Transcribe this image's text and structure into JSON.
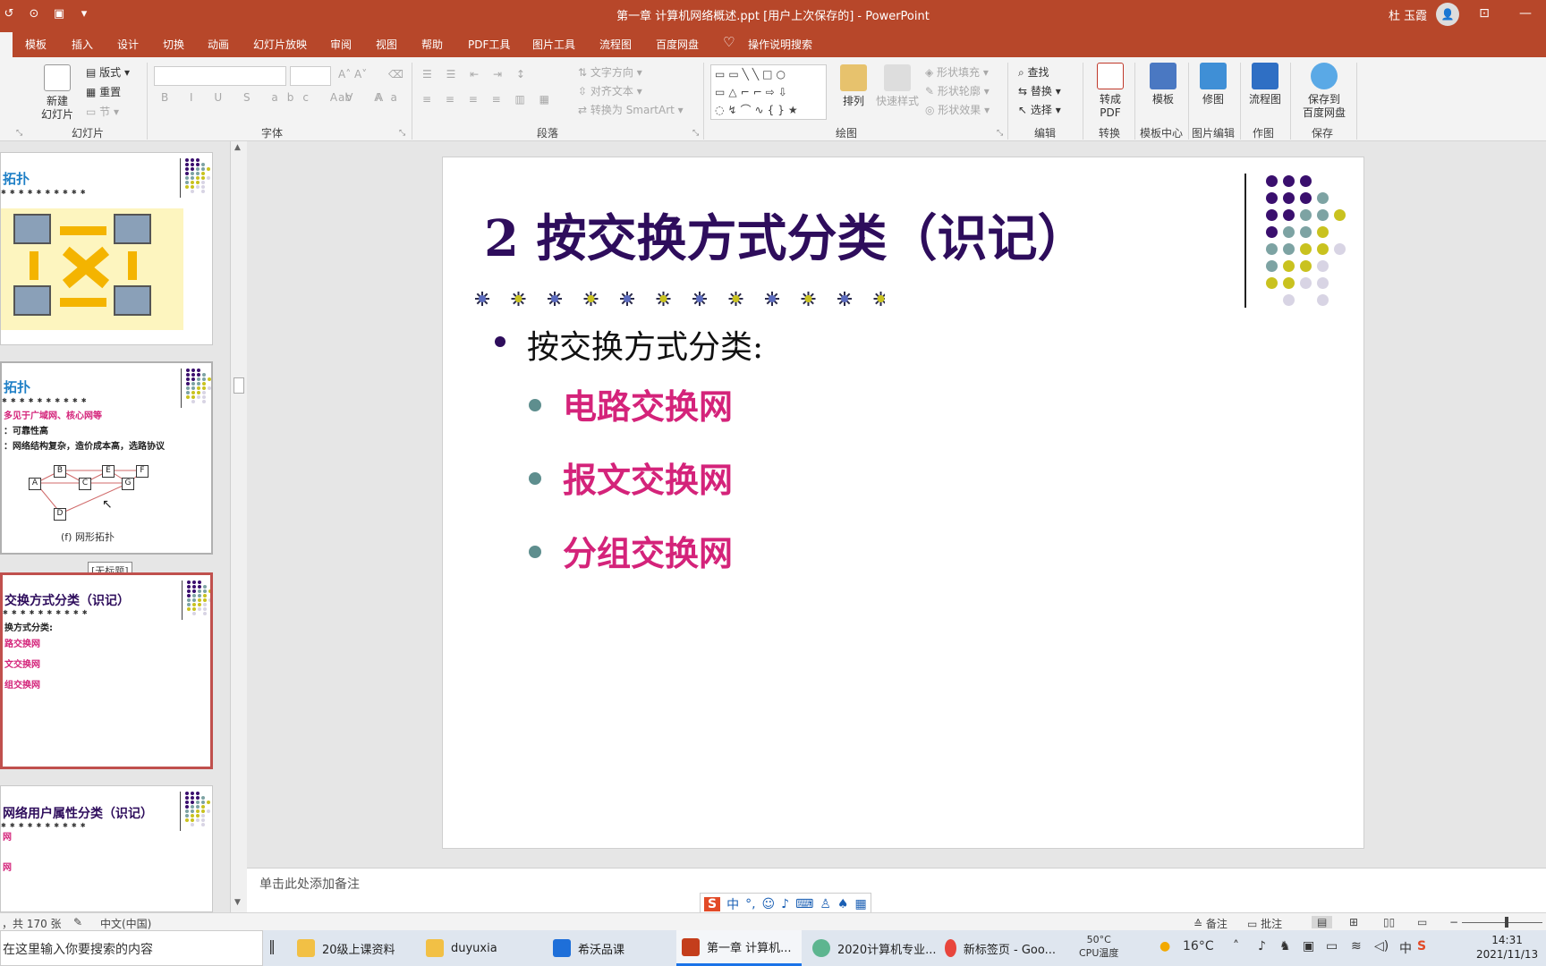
{
  "window": {
    "title": "第一章  计算机网络概述.ppt [用户上次保存的]  -  PowerPoint",
    "user": "杜 玉霞"
  },
  "tabs": [
    "模板",
    "插入",
    "设计",
    "切换",
    "动画",
    "幻灯片放映",
    "审阅",
    "视图",
    "帮助",
    "PDF工具",
    "图片工具",
    "流程图",
    "百度网盘",
    "操作说明搜索"
  ],
  "ribbon": {
    "slides_group": {
      "new_slide": "新建\n幻灯片",
      "layout": "版式",
      "reset": "重置",
      "section": "节",
      "label": "幻灯片"
    },
    "font_group": {
      "label": "字体"
    },
    "paragraph_group": {
      "text_direction": "文字方向",
      "align_text": "对齐文本",
      "smartart": "转换为 SmartArt",
      "label": "段落"
    },
    "drawing_group": {
      "arrange": "排列",
      "quick_styles": "快速样式",
      "shape_fill": "形状填充",
      "shape_outline": "形状轮廓",
      "shape_effects": "形状效果",
      "label": "绘图"
    },
    "editing_group": {
      "find": "查找",
      "replace": "替换",
      "select": "选择",
      "label": "编辑"
    },
    "convert_group": {
      "to_pdf": "转成\nPDF",
      "label": "转换"
    },
    "template_group": {
      "template": "模板",
      "label": "模板中心"
    },
    "picture_group": {
      "retouch": "修图",
      "label": "图片编辑"
    },
    "flow_group": {
      "flowchart": "流程图",
      "label": "作图"
    },
    "save_group": {
      "save": "保存到\n百度网盘",
      "label": "保存"
    }
  },
  "thumbnails": [
    {
      "title": "拓扑"
    },
    {
      "title": "拓扑",
      "lines": [
        "多见于广域网、核心网等",
        "：可靠性高",
        "：网络结构复杂，造价成本高，选路协议"
      ],
      "caption": "(f) 网形拓扑",
      "nodes": [
        "A",
        "B",
        "C",
        "D",
        "E",
        "F",
        "G"
      ]
    },
    {
      "title": "交换方式分类（识记）",
      "lines": [
        "换方式分类:",
        "路交换网",
        "文交换网",
        "组交换网"
      ],
      "tooltip": "[无标题]"
    },
    {
      "title": "网络用户属性分类（识记）",
      "lines": [
        "网",
        "网"
      ]
    }
  ],
  "slide": {
    "title": "2 按交换方式分类（识记）",
    "bullet": "按交换方式分类:",
    "subitems": [
      "电路交换网",
      "报文交换网",
      "分组交换网"
    ]
  },
  "notes_placeholder": "单击此处添加备注",
  "statusbar": {
    "slide_count": "，共 170 张",
    "language": "中文(中国)",
    "notes": "备注",
    "comments": "批注"
  },
  "taskbar": {
    "search": "在这里输入你要搜索的内容",
    "items": [
      "20级上课资料",
      "duyuxia",
      "希沃品课",
      "第一章  计算机...",
      "2020计算机专业...",
      "新标签页 - Goo..."
    ],
    "cpu": {
      "temp": "50°C",
      "label": "CPU温度"
    },
    "weather": "16°C",
    "time": "14:31",
    "date": "2021/11/13"
  },
  "colors": {
    "accent": "#b7472a",
    "title": "#2e0d5c",
    "sub": "#d4237a",
    "teal": "#5e8e8e"
  }
}
